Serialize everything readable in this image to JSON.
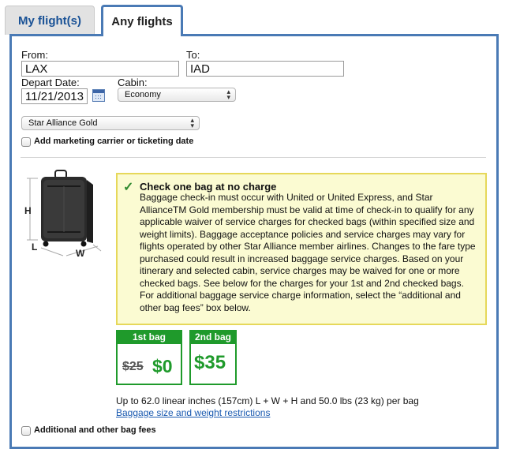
{
  "tabs": [
    {
      "label": "My flight(s)",
      "active": false
    },
    {
      "label": "Any flights",
      "active": true
    }
  ],
  "form": {
    "from_label": "From:",
    "from_value": "LAX",
    "to_label": "To:",
    "to_value": "IAD",
    "depart_label": "Depart Date:",
    "depart_value": "11/21/2013",
    "cabin_label": "Cabin:",
    "cabin_value": "Economy",
    "status_value": "Star Alliance Gold",
    "marketing_label": "Add marketing carrier or ticketing date",
    "marketing_checked": false
  },
  "diagram": {
    "h": "H",
    "l": "L",
    "w": "W"
  },
  "info": {
    "title": "Check one bag at no charge",
    "body": "Baggage check-in must occur with United or United Express, and Star AllianceTM Gold membership must be valid at time of check-in to qualify for any applicable waiver of service charges for checked bags (within specified size and weight limits). Baggage acceptance policies and service charges may vary for flights operated by other Star Alliance member airlines. Changes to the fare type purchased could result in increased baggage service charges. Based on your itinerary and selected cabin, service charges may be waived for one or more checked bags. See below for the charges for your 1st and 2nd checked bags. For additional baggage service charge information, select the “additional and other bag fees” box below."
  },
  "bags": [
    {
      "label": "1st bag",
      "old_price": "$25",
      "price": "$0"
    },
    {
      "label": "2nd bag",
      "price": "$35"
    }
  ],
  "limits_text": "Up to 62.0 linear inches (157cm) L + W + H and 50.0 lbs (23 kg) per bag",
  "restrictions_link": "Baggage size and weight restrictions",
  "additional_label": "Additional and other bag fees",
  "additional_checked": false,
  "colors": {
    "tab_border": "#4a7ab5",
    "bag_green": "#1f9a2b",
    "info_bg": "#fbfbd2",
    "info_border": "#e6d85a",
    "link": "#1a5ab0"
  }
}
